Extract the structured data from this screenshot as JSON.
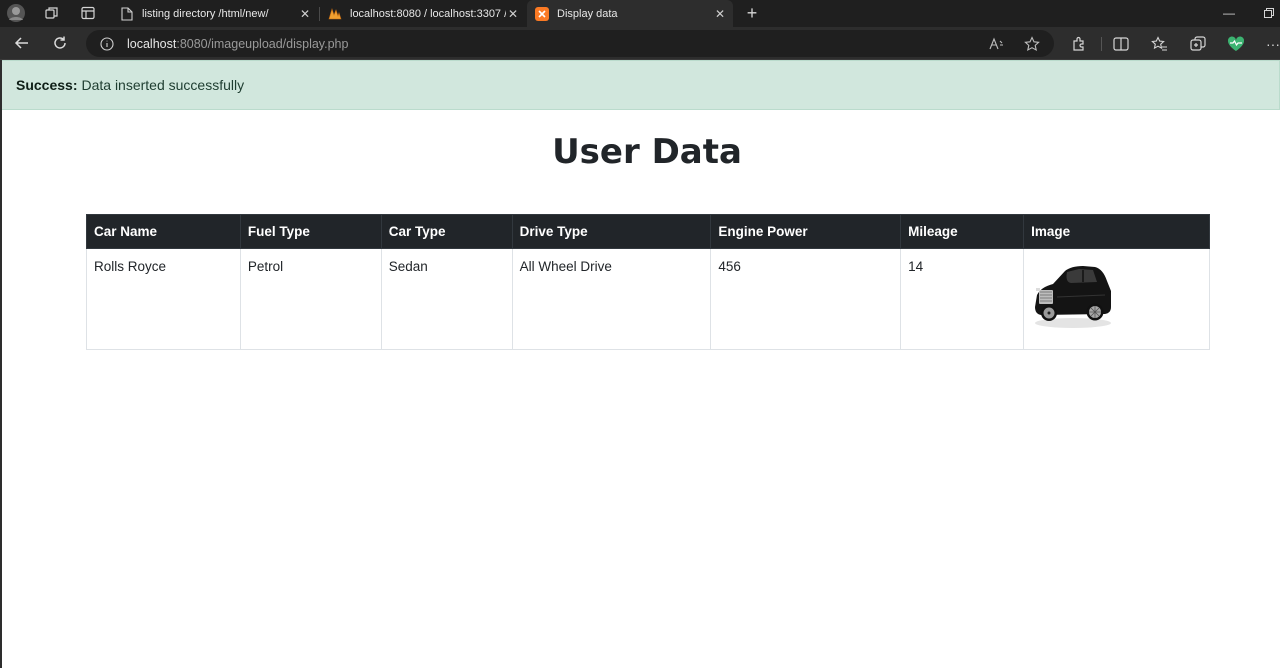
{
  "browser": {
    "tabs": [
      {
        "title": "listing directory /html/new/",
        "active": false,
        "favicon": "document-icon"
      },
      {
        "title": "localhost:8080 / localhost:3307 /",
        "active": false,
        "favicon": "phpmyadmin-icon"
      },
      {
        "title": "Display data",
        "active": true,
        "favicon": "xampp-icon"
      }
    ],
    "url_host": "localhost",
    "url_rest": ":8080/imageupload/display.php"
  },
  "alert": {
    "label": "Success:",
    "message": "Data inserted successfully",
    "color": "#d1e7dd"
  },
  "page": {
    "title": "User Data"
  },
  "table": {
    "headers": [
      "Car Name",
      "Fuel Type",
      "Car Type",
      "Drive Type",
      "Engine Power",
      "Mileage",
      "Image"
    ],
    "rows": [
      {
        "car_name": "Rolls Royce",
        "fuel_type": "Petrol",
        "car_type": "Sedan",
        "drive_type": "All Wheel Drive",
        "engine_power": "456",
        "mileage": "14",
        "image": "car-image"
      }
    ]
  }
}
